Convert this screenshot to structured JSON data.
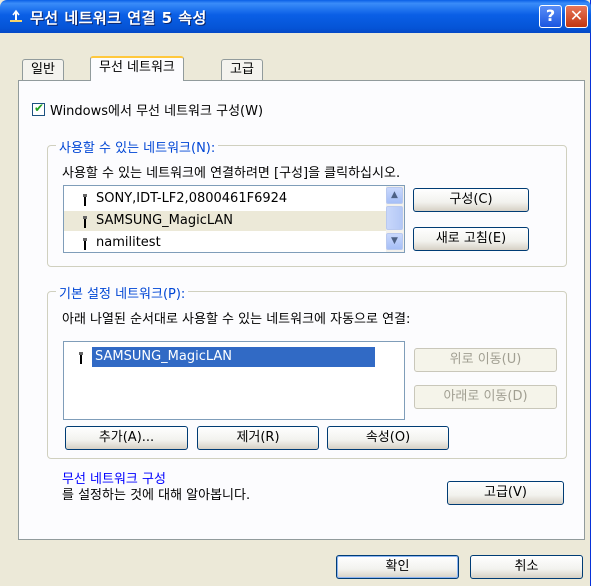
{
  "window": {
    "title": "무선 네트워크 연결 5 속성",
    "help_glyph": "?",
    "close_glyph": "✕"
  },
  "tabs": [
    {
      "label": "일반"
    },
    {
      "label": "무선 네트워크",
      "active": true
    },
    {
      "label": "고급"
    }
  ],
  "config_checkbox": {
    "label": "Windows에서 무선 네트워크 구성(W)",
    "checked": true
  },
  "available": {
    "group_title": "사용할 수 있는 네트워크(N):",
    "description": "사용할 수 있는 네트워크에 연결하려면 [구성]을 클릭하십시오.",
    "networks": [
      {
        "name": "SONY,IDT-LF2,0800461F6924"
      },
      {
        "name": "SAMSUNG_MagicLAN",
        "selected": true
      },
      {
        "name": "namilitest"
      }
    ],
    "configure_button": "구성(C)",
    "refresh_button": "새로 고침(E)"
  },
  "preferred": {
    "group_title": "기본 설정 네트워크(P):",
    "description": "아래 나열된 순서대로 사용할 수 있는 네트워크에 자동으로 연결:",
    "networks": [
      {
        "name": "SAMSUNG_MagicLAN",
        "selected": true
      }
    ],
    "move_up_button": "위로 이동(U)",
    "move_down_button": "아래로 이동(D)",
    "add_button": "추가(A)...",
    "remove_button": "제거(R)",
    "properties_button": "속성(O)"
  },
  "learn_more": {
    "link_text": "무선 네트워크 구성",
    "suffix_text": "를 설정하는 것에 대해 알아봅니다.",
    "advanced_button": "고급(V)"
  },
  "footer": {
    "ok_button": "확인",
    "cancel_button": "취소"
  },
  "colors": {
    "titlebar": "#0a5fe6",
    "group_title": "#0046d5",
    "selection": "#316ac5",
    "link": "#0000ff"
  }
}
